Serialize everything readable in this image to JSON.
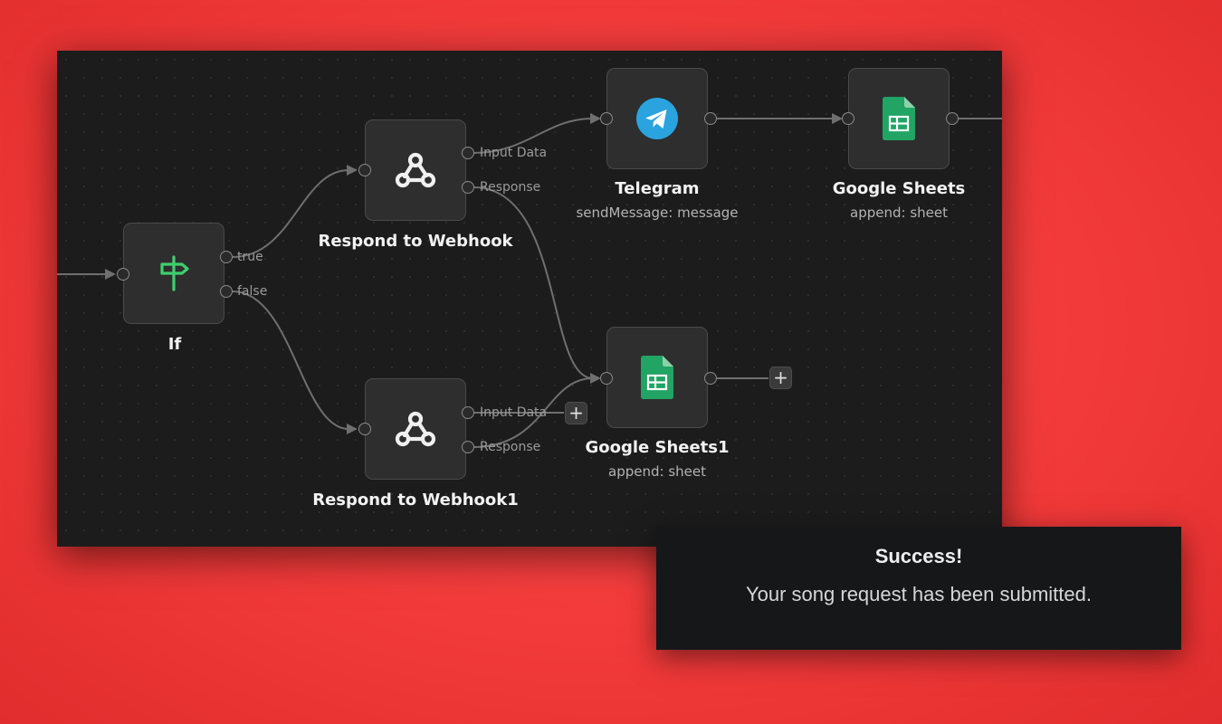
{
  "workflow": {
    "nodes": {
      "if": {
        "title": "If",
        "icon": "signpost-icon",
        "ports": {
          "true": "true",
          "false": "false"
        }
      },
      "respond": {
        "title": "Respond to Webhook",
        "icon": "webhook-icon",
        "ports": {
          "input": "Input Data",
          "response": "Response"
        }
      },
      "respond1": {
        "title": "Respond to Webhook1",
        "icon": "webhook-icon",
        "ports": {
          "input": "Input Data",
          "response": "Response"
        }
      },
      "telegram": {
        "title": "Telegram",
        "subtitle": "sendMessage: message",
        "icon": "telegram-icon"
      },
      "sheets": {
        "title": "Google Sheets",
        "subtitle": "append: sheet",
        "icon": "google-sheets-icon"
      },
      "sheets1": {
        "title": "Google Sheets1",
        "subtitle": "append: sheet",
        "icon": "google-sheets-icon"
      }
    },
    "add_label": "+",
    "colors": {
      "canvas": "#1c1c1c",
      "node_fill": "#2e2e2e",
      "wire": "#6f6f6f",
      "if_green": "#3ecf6e",
      "sheets_green": "#21a464",
      "telegram_blue": "#2aa3df"
    }
  },
  "toast": {
    "title": "Success!",
    "message": "Your song request has been submitted."
  }
}
